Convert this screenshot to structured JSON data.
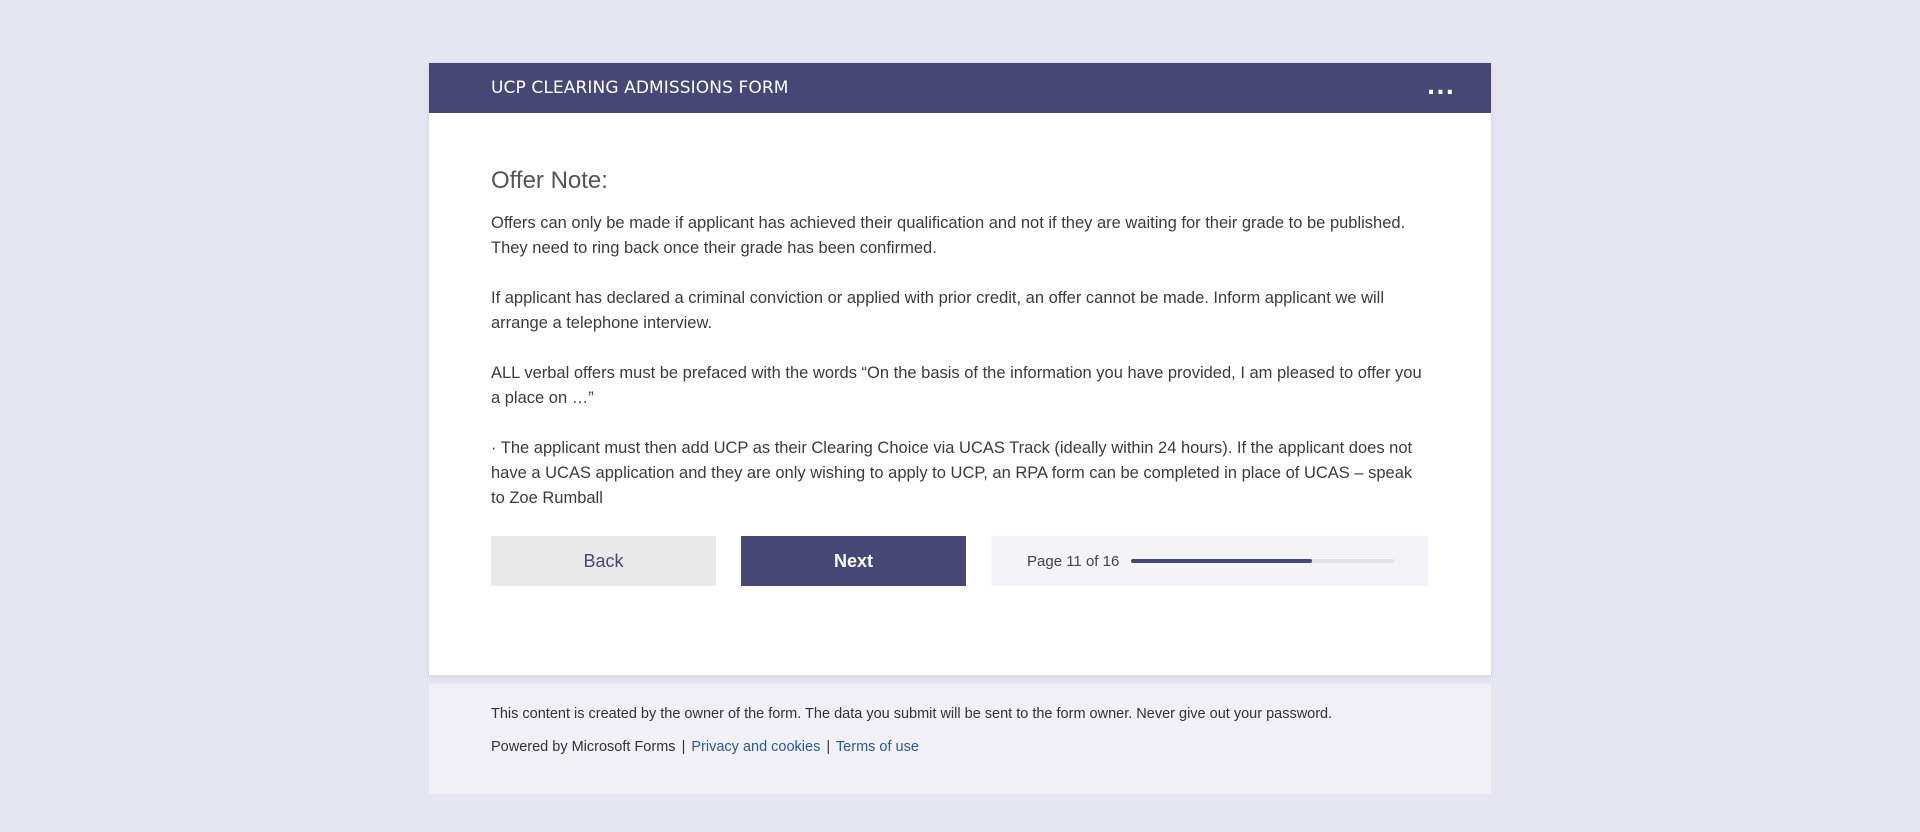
{
  "header": {
    "title": "UCP CLEARING ADMISSIONS FORM",
    "more_label": "..."
  },
  "section": {
    "title": "Offer Note:",
    "paragraphs": [
      "Offers can only be made if applicant has achieved their qualification and not if they are waiting for their grade to be published.  They need to ring back once their grade has been confirmed.",
      "If applicant has declared a criminal conviction or applied with prior credit, an offer cannot be made.  Inform applicant we will arrange a telephone interview.",
      "ALL verbal offers must be prefaced with the words “On the basis of the information you have provided, I am pleased to offer you a place on …”",
      "· The applicant must then add UCP as their Clearing Choice via UCAS Track (ideally within 24 hours). If the applicant does not have a UCAS application and they are only wishing to apply to UCP, an RPA form can be completed in place of UCAS – speak to Zoe Rumball"
    ]
  },
  "nav": {
    "back_label": "Back",
    "next_label": "Next",
    "page_label": "Page 11 of 16",
    "current_page": 11,
    "total_pages": 16,
    "progress_fraction": 0.6875
  },
  "footer": {
    "notice": "This content is created by the owner of the form. The data you submit will be sent to the form owner. Never give out your password.",
    "powered_by": "Powered by Microsoft Forms",
    "separator": "|",
    "privacy_label": "Privacy and cookies",
    "terms_label": "Terms of use"
  },
  "colors": {
    "brand": "#464775",
    "background": "#e6e6f2",
    "link": "#2a5a9c"
  }
}
